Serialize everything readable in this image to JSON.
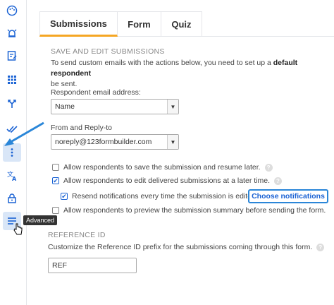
{
  "sidebar": {
    "items": [
      {
        "name": "palette-icon"
      },
      {
        "name": "alarm-icon"
      },
      {
        "name": "form-edit-icon"
      },
      {
        "name": "grid-icon"
      },
      {
        "name": "branch-icon"
      },
      {
        "name": "double-check-icon"
      },
      {
        "name": "more-vertical-icon"
      },
      {
        "name": "translate-icon"
      },
      {
        "name": "lock-icon"
      },
      {
        "name": "menu-icon"
      }
    ],
    "tooltip": "Advanced",
    "accent": "#1b63d4"
  },
  "tabs": {
    "submissions": "Submissions",
    "form": "Form",
    "quiz": "Quiz"
  },
  "section": {
    "heading": "SAVE AND EDIT SUBMISSIONS",
    "description_1": "To send custom emails with the actions below, you need to set up a ",
    "description_bold": "default respondent",
    "description_2": "be sent.",
    "email_label": "Respondent email address:",
    "email_value": "Name",
    "from_label": "From and Reply-to",
    "from_value": "noreply@123formbuilder.com"
  },
  "options": {
    "save_resume": "Allow respondents to save the submission and resume later.",
    "edit_later": "Allow respondents to edit delivered submissions at a later time.",
    "resend": "Resend notifications every time the submission is edited",
    "choose_notifications": "Choose notifications",
    "preview": "Allow respondents to preview the submission summary before sending the form.",
    "help": "?"
  },
  "reference": {
    "heading": "REFERENCE ID",
    "description": "Customize the Reference ID prefix for the submissions coming through this form.",
    "value": "REF"
  }
}
